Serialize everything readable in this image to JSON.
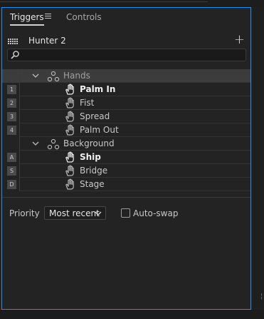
{
  "tabs": {
    "triggers": "Triggers",
    "controls": "Controls",
    "active": "Triggers"
  },
  "rig": {
    "name": "Hunter 2"
  },
  "search": {
    "value": "",
    "placeholder": ""
  },
  "groups": [
    {
      "label": "Hands",
      "expanded": true,
      "selected": true,
      "triggers": [
        {
          "key": "1",
          "label": "Palm In",
          "active": true
        },
        {
          "key": "2",
          "label": "Fist",
          "active": false
        },
        {
          "key": "3",
          "label": "Spread",
          "active": false
        },
        {
          "key": "4",
          "label": "Palm Out",
          "active": false
        }
      ]
    },
    {
      "label": "Background",
      "expanded": true,
      "selected": false,
      "triggers": [
        {
          "key": "A",
          "label": "Ship",
          "active": true
        },
        {
          "key": "S",
          "label": "Bridge",
          "active": false
        },
        {
          "key": "D",
          "label": "Stage",
          "active": false
        }
      ]
    }
  ],
  "priority": {
    "label": "Priority",
    "value": "Most recent"
  },
  "autoswap": {
    "label": "Auto-swap",
    "checked": false
  },
  "colors": {
    "accent_border": "#2d8ceb",
    "panel_bg": "#232323",
    "selected_row": "#3c3c3c"
  },
  "icons": {
    "tab_menu": "hamburger-icon",
    "rig": "grid-icon",
    "add": "plus-icon",
    "search": "search-icon",
    "group": "group-nodes-icon",
    "trigger": "hand-icon",
    "expand": "chevron-down-icon"
  }
}
